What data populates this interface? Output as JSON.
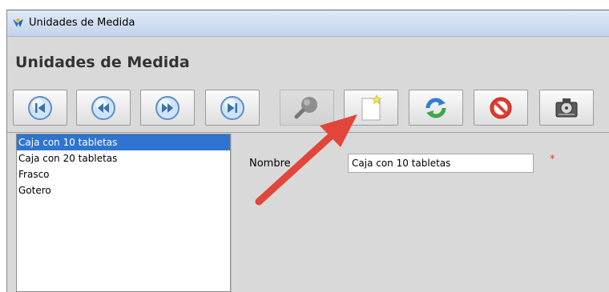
{
  "window": {
    "title": "Unidades de Medida",
    "app_icon": "app-logo-icon"
  },
  "header": {
    "title": "Unidades de Medida"
  },
  "toolbar": {
    "buttons": [
      {
        "name": "first-record-button",
        "icon": "skip-to-first-icon",
        "enabled": true
      },
      {
        "name": "previous-record-button",
        "icon": "rewind-icon",
        "enabled": true
      },
      {
        "name": "next-record-button",
        "icon": "fast-forward-icon",
        "enabled": true
      },
      {
        "name": "last-record-button",
        "icon": "skip-to-last-icon",
        "enabled": true
      },
      {
        "name": "search-button",
        "icon": "magnifier-icon",
        "enabled": false
      },
      {
        "name": "new-record-button",
        "icon": "new-document-star-icon",
        "enabled": true
      },
      {
        "name": "refresh-button",
        "icon": "refresh-icon",
        "enabled": true
      },
      {
        "name": "delete-button",
        "icon": "no-entry-icon",
        "enabled": true
      },
      {
        "name": "save-button",
        "icon": "hard-drive-icon",
        "enabled": true
      }
    ]
  },
  "list": {
    "items": [
      "Caja con 10 tabletas",
      "Caja con 20 tabletas",
      "Frasco",
      "Gotero"
    ],
    "selected_index": 0
  },
  "form": {
    "nombre_label": "Nombre",
    "nombre_value": "Caja con 10 tabletas",
    "required_marker": "*"
  },
  "colors": {
    "selection": "#2f74d0",
    "annotation_arrow": "#e2453a",
    "required": "#e23b3b"
  }
}
